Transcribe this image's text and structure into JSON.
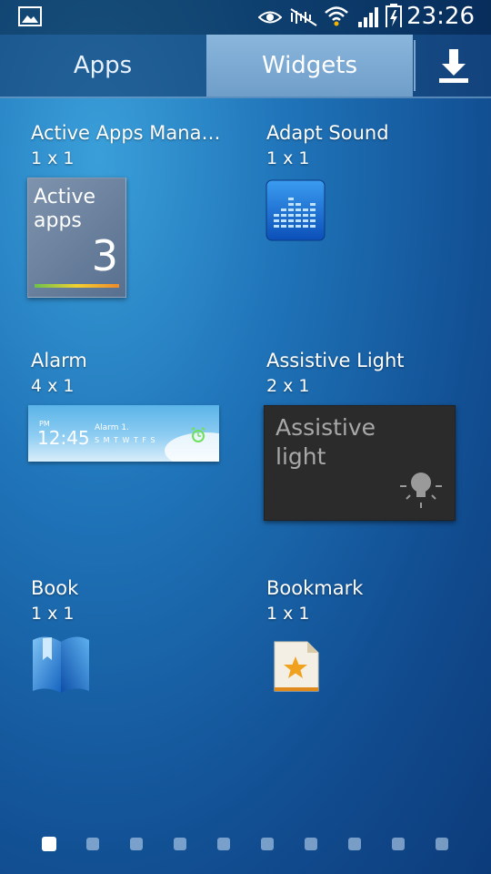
{
  "status_bar": {
    "time": "23:26"
  },
  "tabs": [
    {
      "label": "Apps",
      "selected": false
    },
    {
      "label": "Widgets",
      "selected": true
    }
  ],
  "widgets": [
    {
      "title": "Active Apps Mana…",
      "size": "1 x 1",
      "preview_text": [
        "Active",
        "apps",
        "3"
      ]
    },
    {
      "title": "Adapt Sound",
      "size": "1 x 1"
    },
    {
      "title": "Alarm",
      "size": "4 x 1",
      "preview_text": [
        "PM",
        "12:45",
        "Alarm 1.",
        "S M T W T F S"
      ]
    },
    {
      "title": "Assistive Light",
      "size": "2 x 1",
      "preview_text": [
        "Assistive",
        "light"
      ]
    },
    {
      "title": "Book",
      "size": "1 x 1"
    },
    {
      "title": "Bookmark",
      "size": "1 x 1"
    }
  ],
  "pager": {
    "pages": 10,
    "current": 1
  },
  "icons": {
    "status": [
      "gallery-icon",
      "eye-icon",
      "mute-icon",
      "wifi-icon",
      "signal-icon",
      "battery-charging-icon"
    ],
    "download": "download-icon"
  },
  "colors": {
    "accent_tab": "#7aa9d4",
    "background": "#1a66ad"
  }
}
